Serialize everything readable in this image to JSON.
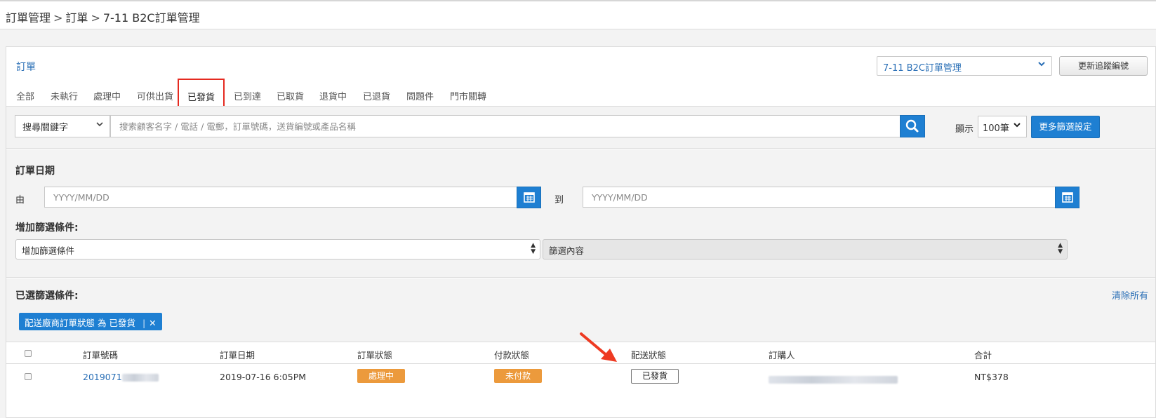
{
  "breadcrumb": {
    "items": [
      "訂單管理",
      "訂單",
      "7-11 B2C訂單管理"
    ],
    "separator": ">"
  },
  "panel": {
    "title": "訂單",
    "template_select": "7-11 B2C訂單管理",
    "update_tracking_button": "更新追蹤編號"
  },
  "tabs": [
    {
      "label": "全部"
    },
    {
      "label": "未執行"
    },
    {
      "label": "處理中"
    },
    {
      "label": "可供出貨"
    },
    {
      "label": "已發貨",
      "active": true
    },
    {
      "label": "已到達"
    },
    {
      "label": "已取貨"
    },
    {
      "label": "退貨中"
    },
    {
      "label": "已退貨"
    },
    {
      "label": "問題件"
    },
    {
      "label": "門市關轉"
    }
  ],
  "search": {
    "keyword_select": "搜尋關鍵字",
    "placeholder": "搜索顧客名字 / 電話 / 電郵，訂單號碼，送貨編號或產品名稱",
    "show_label": "顯示",
    "count_select": "100筆",
    "more_filters_button": "更多篩選設定"
  },
  "date_filter": {
    "title": "訂單日期",
    "from_label": "由",
    "to_label": "到",
    "from_placeholder": "YYYY/MM/DD",
    "to_placeholder": "YYYY/MM/DD"
  },
  "add_filter": {
    "title": "增加篩選條件:",
    "condition_select": "增加篩選條件",
    "content_select": "篩選內容"
  },
  "chosen_filters": {
    "title": "已選篩選條件:",
    "clear_all": "清除所有",
    "chips": [
      {
        "label": "配送廠商訂單狀態 為 已發貨",
        "remove": "✕"
      }
    ]
  },
  "table": {
    "headers": [
      "訂單號碼",
      "訂單日期",
      "訂單狀態",
      "付款狀態",
      "配送狀態",
      "訂購人",
      "合計"
    ],
    "rows": [
      {
        "order_no": "2019071",
        "date": "2019-07-16 6:05PM",
        "order_status": "處理中",
        "payment_status": "未付款",
        "delivery_status": "已發貨",
        "total": "NT$378"
      }
    ]
  },
  "colors": {
    "accent_blue": "#1e7fd2",
    "link_blue": "#2a6fb6",
    "orange": "#ec9a3c",
    "highlight_red": "#e52a20"
  }
}
